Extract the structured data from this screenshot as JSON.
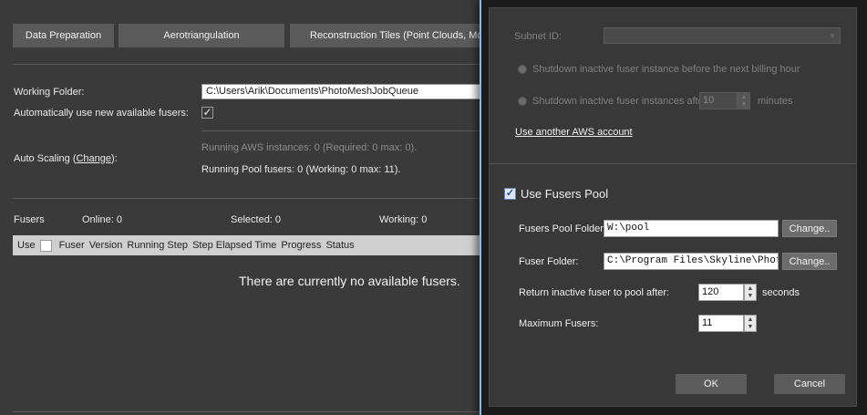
{
  "toolbar": {
    "data_preparation": "Data Preparation",
    "aerotriangulation": "Aerotriangulation",
    "reconstruction_tiles": "Reconstruction Tiles (Point Clouds, Mo"
  },
  "settings": {
    "working_folder_label": "Working Folder:",
    "working_folder_value": "C:\\Users\\Arik\\Documents\\PhotoMeshJobQueue",
    "auto_use_label": "Automatically use new available fusers:",
    "auto_use_checked": "✓",
    "auto_scaling_label": "Auto Scaling (",
    "auto_scaling_link": "Change",
    "auto_scaling_suffix": "):",
    "running_aws": "Running AWS instances: 0  (Required: 0  max: 0).",
    "running_pool": "Running Pool fusers:  0  (Working:  0  max:  11)."
  },
  "fusers_bar": {
    "title": "Fusers",
    "online": "Online: 0",
    "selected": "Selected: 0",
    "working": "Working: 0"
  },
  "grid": {
    "columns": [
      "Use",
      "Fuser",
      "Version",
      "Running Step",
      "Step Elapsed Time",
      "Progress",
      "Status"
    ],
    "empty_message": "There are currently no available fusers."
  },
  "dialog": {
    "subnet_label": "Subnet ID:",
    "shutdown_billing": "Shutdown inactive fuser instance before the next billing hour",
    "shutdown_after": "Shutdown inactive fuser instances after:",
    "shutdown_minutes_value": "10",
    "minutes_unit": "minutes",
    "another_aws": "Use another AWS account",
    "use_pool_label": "Use Fusers Pool",
    "use_pool_checked": "✓",
    "pool_folder_label": "Fusers Pool Folder:",
    "pool_folder_value": "W:\\pool",
    "fuser_folder_label": "Fuser Folder:",
    "fuser_folder_value": "C:\\Program Files\\Skyline\\PhotoMesh",
    "change_label": "Change..",
    "return_label": "Return inactive fuser to pool after:",
    "return_value": "120",
    "seconds_unit": "seconds",
    "max_fusers_label": "Maximum Fusers:",
    "max_fusers_value": "11",
    "ok": "OK",
    "cancel": "Cancel"
  }
}
